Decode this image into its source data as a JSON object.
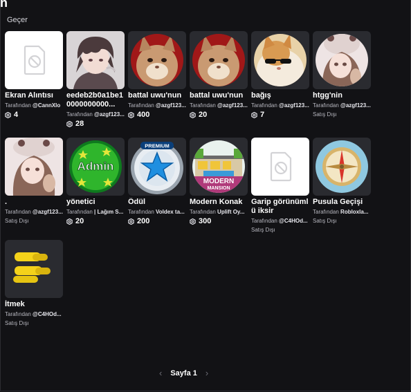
{
  "page": {
    "title_fragment": "n",
    "skip_label": "Geçer"
  },
  "items": [
    {
      "name": "Ekran Alıntısı",
      "by_prefix": "Tarafından",
      "creator": "@CannXlo",
      "price": "4",
      "status": ""
    },
    {
      "name": "eedeb2b0a1be10000000000...",
      "by_prefix": "Tarafından",
      "creator": "@azgf123...",
      "price": "28",
      "status": ""
    },
    {
      "name": "battal uwu'nun",
      "by_prefix": "Tarafından",
      "creator": "@azgf123...",
      "price": "400",
      "status": ""
    },
    {
      "name": "battal uwu'nun",
      "by_prefix": "Tarafından",
      "creator": "@azgf123...",
      "price": "20",
      "status": ""
    },
    {
      "name": "bağış",
      "by_prefix": "Tarafından",
      "creator": "@azgf123...",
      "price": "7",
      "status": ""
    },
    {
      "name": "htgg'nin",
      "by_prefix": "Tarafından",
      "creator": "@azgf123...",
      "price": "",
      "status": "Satış Dışı"
    },
    {
      "name": ".",
      "by_prefix": "Tarafından",
      "creator": "@azgf123...",
      "price": "",
      "status": "Satış Dışı"
    },
    {
      "name": "yönetici",
      "by_prefix": "Tarafından",
      "creator": "| Lağım S...",
      "price": "20",
      "status": ""
    },
    {
      "name": "Ödül",
      "by_prefix": "Tarafından",
      "creator": "Voldex ta...",
      "price": "200",
      "status": ""
    },
    {
      "name": "Modern Konak",
      "by_prefix": "Tarafından",
      "creator": "Uplift Oy...",
      "price": "300",
      "status": ""
    },
    {
      "name": "Garip görünümlü iksir",
      "by_prefix": "Tarafından",
      "creator": "@C4HOd...",
      "price": "",
      "status": "Satış Dışı"
    },
    {
      "name": "Pusula Geçişi",
      "by_prefix": "Tarafından",
      "creator": "Robloxla...",
      "price": "",
      "status": "Satış Dışı"
    },
    {
      "name": "İtmek",
      "by_prefix": "Tarafından",
      "creator": "@C4HOd...",
      "price": "",
      "status": "Satış Dışı"
    }
  ],
  "thumb_text": {
    "admin": "Admin",
    "premium": "PREMIUM",
    "modern": "MODERN",
    "mansion": "MANSION"
  },
  "pager": {
    "label": "Sayfa 1",
    "prev_icon": "chevron-left-icon",
    "next_icon": "chevron-right-icon"
  },
  "colors": {
    "background": "#121215",
    "card": "#2a2b30",
    "text_muted": "#b8b8c0"
  }
}
